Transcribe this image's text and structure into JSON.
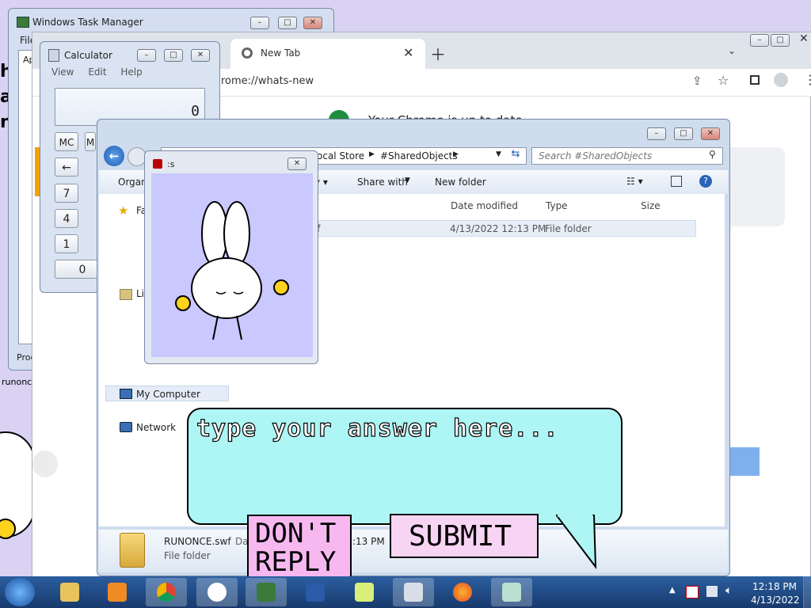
{
  "task_manager": {
    "title": "Windows Task Manager",
    "menu_fragment": "File",
    "tab_fragment": "Ap",
    "footer_fragment": "Proc"
  },
  "chrome": {
    "tab_title": "New Tab",
    "address": "chrome://whats-new",
    "address_visible": "rome://whats-new",
    "update_text": "Your Chrome is up to date"
  },
  "calculator": {
    "title": "Calculator",
    "menu": [
      "View",
      "Edit",
      "Help"
    ],
    "display": "0",
    "keys": {
      "mc": "MC",
      "m_frag": "M",
      "back": "←",
      "seven": "7",
      "four": "4",
      "one": "1",
      "zero": "0"
    }
  },
  "explorer": {
    "breadcrumb": [
      "ocal Store",
      "#SharedObjects"
    ],
    "search_placeholder": "Search #SharedObjects",
    "toolbar": {
      "organize": "Organ",
      "share_with": "Share with",
      "new_folder": "New folder"
    },
    "columns": {
      "date_modified": "Date modified",
      "type": "Type",
      "size": "Size"
    },
    "row": {
      "name_fragment": "f",
      "date": "4/13/2022 12:13 PM",
      "type": "File folder"
    },
    "nav": {
      "favorites": "Fa",
      "libraries": "Li",
      "computer": "My Computer",
      "network": "Network"
    },
    "details": {
      "name": "RUNONCE.swf",
      "date_prefix": "Da",
      "date_fragment": ":13 PM",
      "type": "File folder"
    }
  },
  "flash_player": {
    "title": ":s"
  },
  "desktop": {
    "side_fragment_1": "he",
    "side_fragment_2": "a",
    "side_fragment_3": "n",
    "runonce_fragment": "runonc"
  },
  "dialog": {
    "prompt_placeholder": "type your answer here...",
    "dont_reply_line1": "DON'T",
    "dont_reply_line2": "REPLY",
    "submit_label": "SUBMIT"
  },
  "taskbar": {
    "time": "12:18 PM",
    "date": "4/13/2022"
  },
  "colors": {
    "bubble": "#aef5f5",
    "button_pink": "#f7b8f0",
    "taskbar": "#1e4f8f",
    "lavender": "#c9c8ff"
  }
}
